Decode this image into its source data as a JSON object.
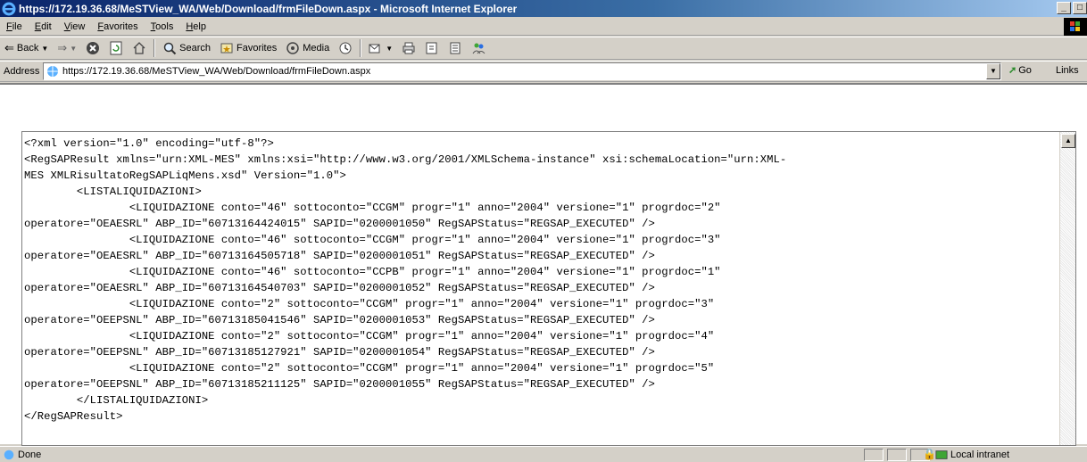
{
  "window": {
    "title": "https://172.19.36.68/MeSTView_WA/Web/Download/frmFileDown.aspx - Microsoft Internet Explorer",
    "minimize": "_",
    "maximize": "□"
  },
  "menu": [
    "File",
    "Edit",
    "View",
    "Favorites",
    "Tools",
    "Help"
  ],
  "toolbar": {
    "back": "Back",
    "search": "Search",
    "favorites": "Favorites",
    "media": "Media"
  },
  "address": {
    "label": "Address",
    "url": "https://172.19.36.68/MeSTView_WA/Web/Download/frmFileDown.aspx",
    "go": "Go",
    "links": "Links"
  },
  "xml_lines": [
    "<?xml version=\"1.0\" encoding=\"utf-8\"?>",
    "<RegSAPResult xmlns=\"urn:XML-MES\" xmlns:xsi=\"http://www.w3.org/2001/XMLSchema-instance\" xsi:schemaLocation=\"urn:XML-",
    "MES XMLRisultatoRegSAPLiqMens.xsd\" Version=\"1.0\">",
    "        <LISTALIQUIDAZIONI>",
    "                <LIQUIDAZIONE conto=\"46\" sottoconto=\"CCGM\" progr=\"1\" anno=\"2004\" versione=\"1\" progrdoc=\"2\"",
    "operatore=\"OEAESRL\" ABP_ID=\"60713164424015\" SAPID=\"0200001050\" RegSAPStatus=\"REGSAP_EXECUTED\" />",
    "                <LIQUIDAZIONE conto=\"46\" sottoconto=\"CCGM\" progr=\"1\" anno=\"2004\" versione=\"1\" progrdoc=\"3\"",
    "operatore=\"OEAESRL\" ABP_ID=\"60713164505718\" SAPID=\"0200001051\" RegSAPStatus=\"REGSAP_EXECUTED\" />",
    "                <LIQUIDAZIONE conto=\"46\" sottoconto=\"CCPB\" progr=\"1\" anno=\"2004\" versione=\"1\" progrdoc=\"1\"",
    "operatore=\"OEAESRL\" ABP_ID=\"60713164540703\" SAPID=\"0200001052\" RegSAPStatus=\"REGSAP_EXECUTED\" />",
    "                <LIQUIDAZIONE conto=\"2\" sottoconto=\"CCGM\" progr=\"1\" anno=\"2004\" versione=\"1\" progrdoc=\"3\"",
    "operatore=\"OEEPSNL\" ABP_ID=\"60713185041546\" SAPID=\"0200001053\" RegSAPStatus=\"REGSAP_EXECUTED\" />",
    "                <LIQUIDAZIONE conto=\"2\" sottoconto=\"CCGM\" progr=\"1\" anno=\"2004\" versione=\"1\" progrdoc=\"4\"",
    "operatore=\"OEEPSNL\" ABP_ID=\"60713185127921\" SAPID=\"0200001054\" RegSAPStatus=\"REGSAP_EXECUTED\" />",
    "                <LIQUIDAZIONE conto=\"2\" sottoconto=\"CCGM\" progr=\"1\" anno=\"2004\" versione=\"1\" progrdoc=\"5\"",
    "operatore=\"OEEPSNL\" ABP_ID=\"60713185211125\" SAPID=\"0200001055\" RegSAPStatus=\"REGSAP_EXECUTED\" />",
    "        </LISTALIQUIDAZIONI>",
    "</RegSAPResult>"
  ],
  "status": {
    "text": "Done",
    "zone": "Local intranet"
  },
  "colors": {
    "titlebar_start": "#0a246a",
    "titlebar_end": "#a6caf0",
    "chrome": "#d4d0c8"
  }
}
